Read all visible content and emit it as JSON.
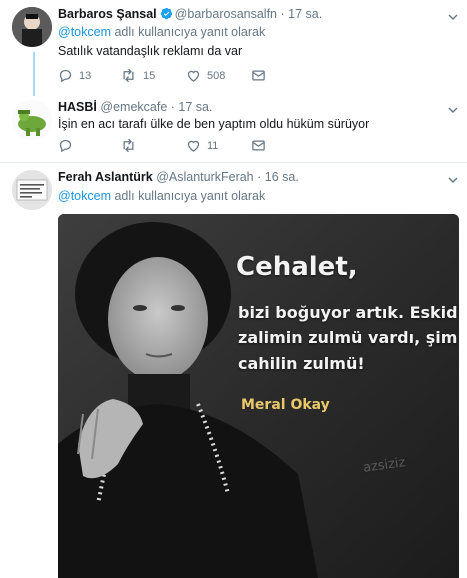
{
  "tweets": [
    {
      "name": "Barbaros Şansal",
      "handle": "@barbarosansalfn",
      "time": "· 17 sa.",
      "reply_mention": "@tokcem",
      "reply_suffix": " adlı kullanıcıya yanıt olarak",
      "text": "Satılık vatandaşlık reklamı da var",
      "replies": "13",
      "retweets": "15",
      "likes": "508",
      "verified": true
    },
    {
      "name": "HASBİ",
      "handle": "@emekcafe",
      "time": "· 17 sa.",
      "text": "İşin en acı tarafı ülke de ben yaptım oldu hüküm sürüyor",
      "replies": "",
      "retweets": "",
      "likes": "11"
    },
    {
      "name": "Ferah Aslantürk",
      "handle": "@AslanturkFerah",
      "time": "· 16 sa.",
      "reply_mention": "@tokcem",
      "reply_suffix": " adlı kullanıcıya yanıt olarak",
      "media": {
        "quote_title": "Cehalet,",
        "quote_lines": [
          "bizi boğuyor artık. Eskid",
          "zalimin zulmü vardı, şim",
          "cahilin zulmü!"
        ],
        "quote_author": "Meral Okay",
        "watermark": "azsiziz"
      }
    }
  ],
  "colors": {
    "accent": "#1b95e0",
    "muted": "#657786",
    "thread_line": "#a4d9f5",
    "divider": "#e6ecf0"
  },
  "icons": [
    "reply-icon",
    "retweet-icon",
    "like-icon",
    "message-icon",
    "chevron-down-icon",
    "verified-badge-icon"
  ]
}
